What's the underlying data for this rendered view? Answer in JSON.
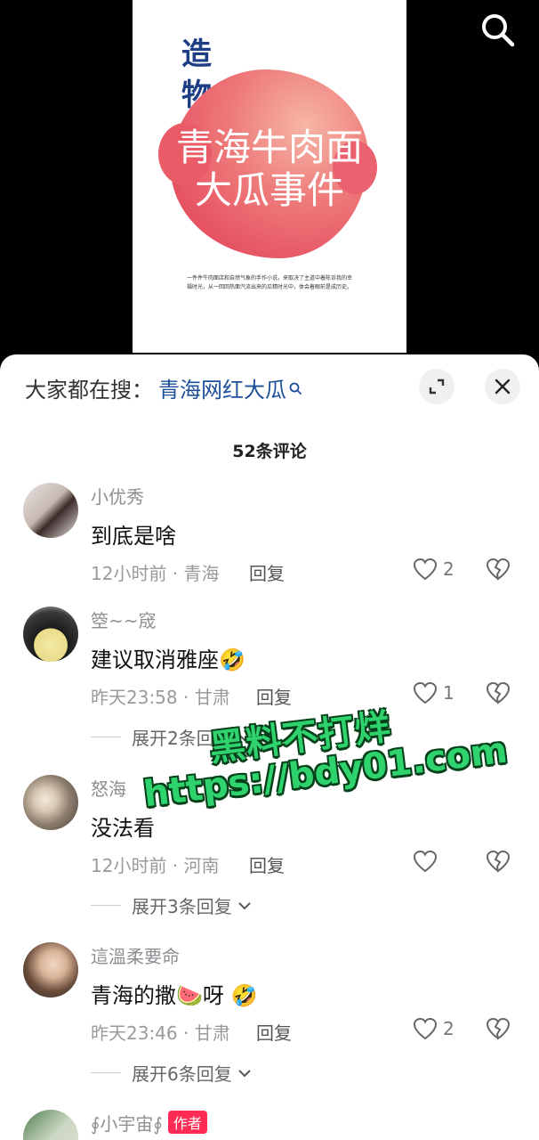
{
  "poster": {
    "vertical_text": "造物",
    "title": "青海牛肉面大瓜事件",
    "description": "一件件牛肉面店和自然气象的手作小说，来取决了主道中着陈诉我的幸福时光，从一回回热面汽流出来的瓜精时光中，体会着眼前是成历史。"
  },
  "search_icon": "search-icon",
  "sheet": {
    "search_prefix": "大家都在搜：",
    "search_link": "青海网红大瓜",
    "comment_count": "52条评论"
  },
  "comments": [
    {
      "username": "小优秀",
      "text": "到底是啥",
      "meta": "12小时前 · 青海",
      "reply": "回复",
      "likes": "2",
      "expand": ""
    },
    {
      "username": "箜~~窚",
      "text": "建议取消雅座🤣",
      "meta": "昨天23:58 · 甘肃",
      "reply": "回复",
      "likes": "1",
      "expand": "展开2条回复"
    },
    {
      "username": "怒海",
      "text": "没法看",
      "meta": "12小时前 · 河南",
      "reply": "回复",
      "likes": "",
      "expand": "展开3条回复"
    },
    {
      "username": "這溫柔要命",
      "text": "青海的撒🍉呀 🤣",
      "meta": "昨天23:46 · 甘肃",
      "reply": "回复",
      "likes": "2",
      "expand": "展开6条回复"
    },
    {
      "username": "∮小宇宙∮",
      "author_badge": "作者"
    }
  ],
  "watermark": {
    "line1": "黑料不打烊",
    "line2": "https://bdy01.com"
  },
  "colors": {
    "link": "#1d4f9a",
    "poster_accent": "#e65462",
    "badge": "#fe2c55",
    "watermark": "#2fd36d"
  }
}
